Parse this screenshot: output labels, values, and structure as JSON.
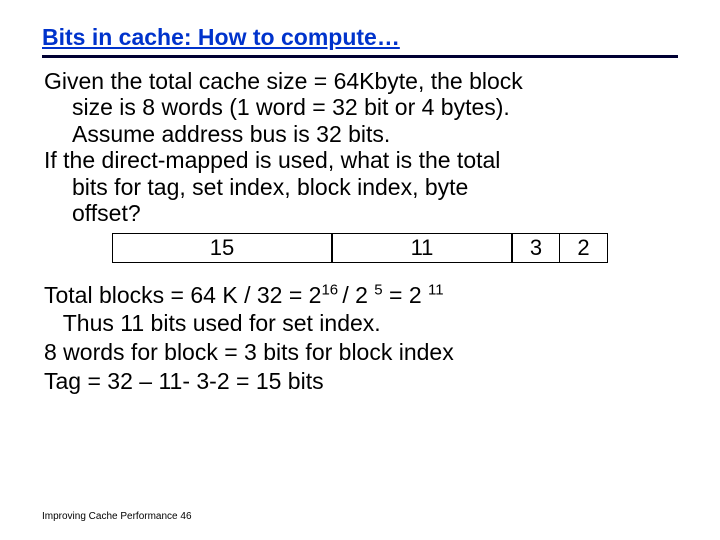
{
  "title": "Bits in cache: How to compute…",
  "para": {
    "line1": "Given the total cache size = 64Kbyte, the block",
    "line2": "size is 8 words (1 word = 32 bit or 4 bytes).",
    "line3": "Assume address bus is 32 bits.",
    "line4": "If the direct-mapped is used,  what is the total",
    "line5": "bits for tag, set index, block index, byte",
    "line6": "offset?"
  },
  "bits": {
    "tag": "15",
    "set": "11",
    "block": "3",
    "byte": "2"
  },
  "calc": {
    "l1a": "Total blocks = 64 K / 32 = 2",
    "l1b": "/ 2 ",
    "l1c": " = 2 ",
    "exp16": "16 ",
    "exp5": "5",
    "exp11": "11",
    "l2": "   Thus 11 bits used for set index.",
    "l3": "8 words for block = 3 bits for block index",
    "l4": "Tag = 32 – 11- 3-2 = 15 bits"
  },
  "footer": "Improving Cache Performance 46"
}
